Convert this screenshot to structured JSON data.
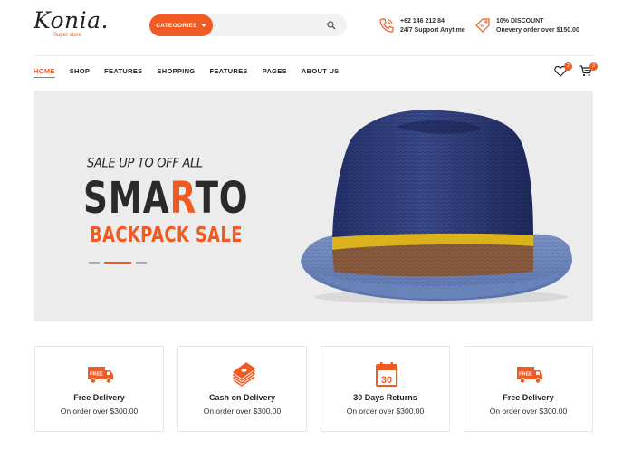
{
  "brand": {
    "name": "Konia.",
    "tagline": "Super store",
    "accent": "#f15a22"
  },
  "search": {
    "category_label": "CATEGORIES",
    "placeholder": ""
  },
  "contacts": [
    {
      "icon": "phone-icon",
      "line1": "+62 146 212 84",
      "line2": "24/7 Support Anytime"
    },
    {
      "icon": "discount-tag-icon",
      "line1": "10% DISCOUNT",
      "line2": "Onevery order over $150.00"
    }
  ],
  "nav": {
    "items": [
      {
        "label": "HOME",
        "active": true
      },
      {
        "label": "SHOP"
      },
      {
        "label": "FEATURES"
      },
      {
        "label": "SHOPPING"
      },
      {
        "label": "FEATURES"
      },
      {
        "label": "PAGES"
      },
      {
        "label": "ABOUT US"
      }
    ],
    "wishlist_count": "2",
    "cart_count": "3"
  },
  "hero": {
    "pre_title": "SALE UP TO OFF ALL",
    "title_part1": "SMA",
    "title_highlight": "R",
    "title_part2": "TO",
    "subtitle": "BACKPACK SALE",
    "slides": 3,
    "active_slide": 2
  },
  "features": [
    {
      "icon": "free-delivery-truck-icon",
      "title": "Free Delivery",
      "subtitle": "On order over $300.00"
    },
    {
      "icon": "cash-stack-icon",
      "title": "Cash on Delivery",
      "subtitle": "On order over $300.00"
    },
    {
      "icon": "calendar-30-icon",
      "title": "30 Days Returns",
      "subtitle": "On order over $300.00"
    },
    {
      "icon": "free-delivery-truck-icon",
      "title": "Free Delivery",
      "subtitle": "On order over $300.00"
    }
  ]
}
